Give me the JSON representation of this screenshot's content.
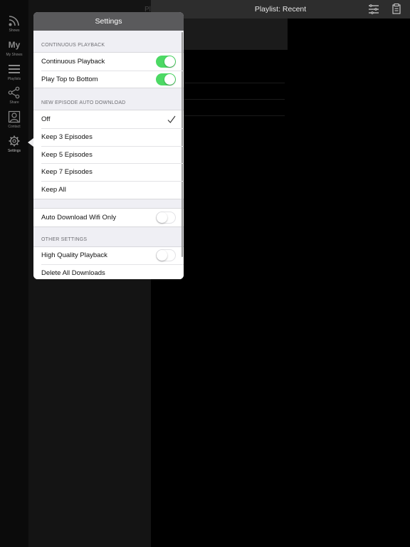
{
  "tabbar": {
    "items": [
      {
        "label": "Shows",
        "icon": "rss-icon"
      },
      {
        "label": "My Shows",
        "icon": "my-text-icon",
        "icon_text": "My"
      },
      {
        "label": "Playlists",
        "icon": "playlist-icon"
      },
      {
        "label": "Share",
        "icon": "share-icon"
      },
      {
        "label": "Contact",
        "icon": "contact-icon"
      },
      {
        "label": "Settings",
        "icon": "gear-icon",
        "active": true
      }
    ]
  },
  "navbar": {
    "title": "Playlist: Recent",
    "ghost_text": "Pl"
  },
  "settings": {
    "title": "Settings",
    "sections": [
      {
        "header": "CONTINUOUS PLAYBACK",
        "rows": [
          {
            "label": "Continuous Playback",
            "toggle": true
          },
          {
            "label": "Play Top to Bottom",
            "toggle": true
          }
        ]
      },
      {
        "header": "NEW EPISODE AUTO DOWNLOAD",
        "rows": [
          {
            "label": "Off",
            "checked": true
          },
          {
            "label": "Keep 3 Episodes"
          },
          {
            "label": "Keep 5 Episodes"
          },
          {
            "label": "Keep 7 Episodes"
          },
          {
            "label": "Keep All"
          }
        ]
      },
      {
        "header": "",
        "rows": [
          {
            "label": "Auto Download Wifi Only",
            "toggle": false
          }
        ]
      },
      {
        "header": "OTHER SETTINGS",
        "rows": [
          {
            "label": "High Quality Playback",
            "toggle": false
          },
          {
            "label": "Delete All Downloads"
          }
        ]
      }
    ]
  },
  "colors": {
    "toggle_on": "#4cd964",
    "popover_header": "#5a5a5c",
    "grouped_background": "#efeff4"
  }
}
